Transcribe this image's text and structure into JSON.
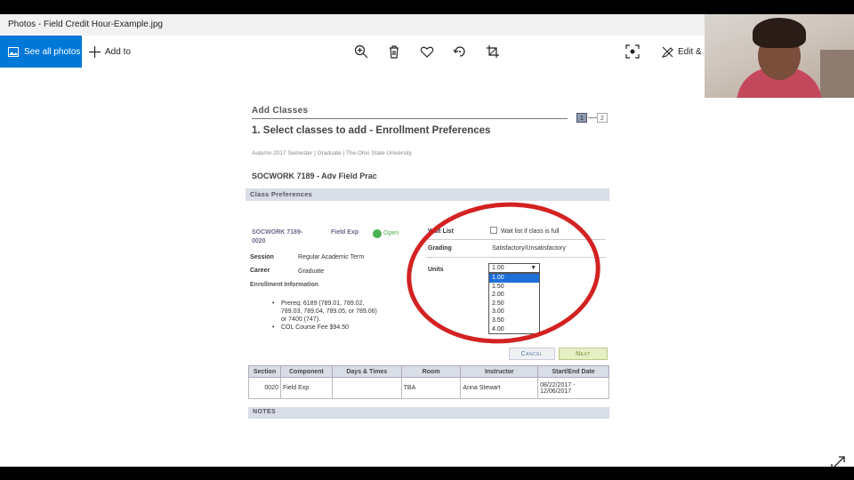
{
  "window": {
    "title": "Photos - Field Credit Hour-Example.jpg"
  },
  "toolbar": {
    "see_all_label": "See all photos",
    "add_to_label": "Add to",
    "edit_label": "Edit & C",
    "icons": [
      "zoom-in-icon",
      "delete-icon",
      "heart-icon",
      "rotate-icon",
      "crop-icon",
      "enhance-icon",
      "edit-icon"
    ]
  },
  "doc": {
    "page_title": "Add Classes",
    "step1": "1",
    "step2": "2",
    "heading": "1.  Select classes to add - Enrollment Preferences",
    "semester": "Autumn 2017 Semester | Graduate | The Ohio State University",
    "course": "SOCWORK 7189 - Adv Field Prac",
    "pref_header": "Class Preferences",
    "class_code_1": "SOCWORK 7189-",
    "class_code_2": "0020",
    "class_type": "Field Exp",
    "status": "Open",
    "session_label": "Session",
    "session_value": "Regular Academic Term",
    "career_label": "Career",
    "career_value": "Graduate",
    "enroll_info": "Enrollment Information",
    "prereq_1": "Prereq: 6189 (789.01, 789.02,",
    "prereq_2": "789.03, 789.04, 789.05, or 789.06)",
    "prereq_3": "or 7400 (747).",
    "fee": "COL Course Fee $94.50",
    "waitlist_label": "Wait List",
    "waitlist_check": "Wait list if class is full",
    "grading_label": "Grading",
    "grading_value": "Satisfactory/Unsatisfactory",
    "units_label": "Units",
    "units_selected": "1.00",
    "units_options": [
      "1.00",
      "1.50",
      "2.00",
      "2.50",
      "3.00",
      "3.50",
      "4.00"
    ],
    "cancel": "Cancel",
    "next": "Next",
    "table": {
      "headers": [
        "Section",
        "Component",
        "Days & Times",
        "Room",
        "Instructor",
        "Start/End Date"
      ],
      "row": [
        "0020",
        "Field Exp",
        "",
        "TBA",
        "Anna Stewart",
        "08/22/2017 - 12/06/2017"
      ]
    },
    "notes_header": "NOTES"
  },
  "colors": {
    "accent": "#0078d7",
    "annotation": "#d32222"
  }
}
